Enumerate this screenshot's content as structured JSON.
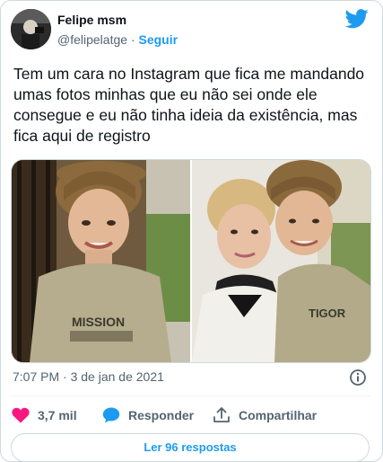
{
  "author": {
    "name": "Felipe msm",
    "handle": "@felipelatge",
    "separator": "·",
    "follow_label": "Seguir"
  },
  "tweet": {
    "text": "Tem um cara no Instagram que fica me mandando umas fotos minhas que eu não sei onde ele consegue e eu não tinha ideia da existência, mas fica aqui de registro",
    "timestamp": "7:07 PM · 3 de jan de 2021",
    "photos": [
      {
        "shirt_text": "MISSION"
      },
      {
        "shirt_text": "TIGOR"
      }
    ]
  },
  "actions": {
    "likes": "3,7 mil",
    "reply_label": "Responder",
    "share_label": "Compartilhar",
    "read_replies_label": "Ler 96 respostas"
  },
  "colors": {
    "accent": "#1d9bf0",
    "like": "#f91880",
    "muted": "#536471",
    "border": "#cfd9de"
  },
  "icons": {
    "brand": "twitter-bird-icon",
    "info": "info-icon",
    "like": "heart-icon",
    "reply": "speech-bubble-icon",
    "share": "share-upload-icon"
  }
}
